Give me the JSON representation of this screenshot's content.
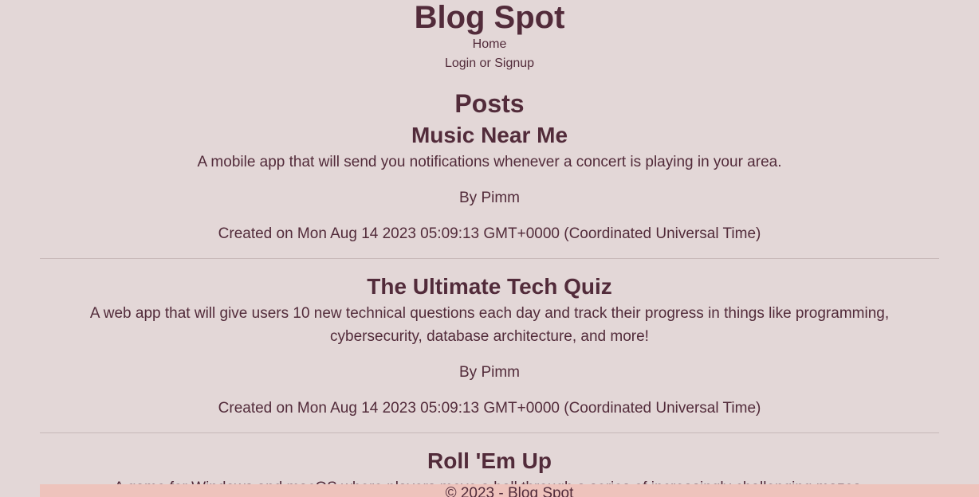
{
  "header": {
    "site_title": "Blog Spot",
    "nav": [
      {
        "label": "Home"
      },
      {
        "label": "Login or Signup"
      }
    ]
  },
  "main": {
    "heading": "Posts",
    "posts": [
      {
        "title": "Music Near Me",
        "description": "A mobile app that will send you notifications whenever a concert is playing in your area.",
        "author": "By Pimm",
        "created": "Created on Mon Aug 14 2023 05:09:13 GMT+0000 (Coordinated Universal Time)"
      },
      {
        "title": "The Ultimate Tech Quiz",
        "description": "A web app that will give users 10 new technical questions each day and track their progress in things like programming, cybersecurity, database architecture, and more!",
        "author": "By Pimm",
        "created": "Created on Mon Aug 14 2023 05:09:13 GMT+0000 (Coordinated Universal Time)"
      },
      {
        "title": "Roll 'Em Up",
        "description": "A game for Windows and macOS where players move a ball through a series of increasingly challenging mazes."
      }
    ]
  },
  "footer": {
    "text": "© 2023 - Blog Spot"
  },
  "colors": {
    "background": "#e3d7d7",
    "text": "#522b3a",
    "footer_background": "#eec3bc",
    "divider": "#c7b8b8"
  }
}
